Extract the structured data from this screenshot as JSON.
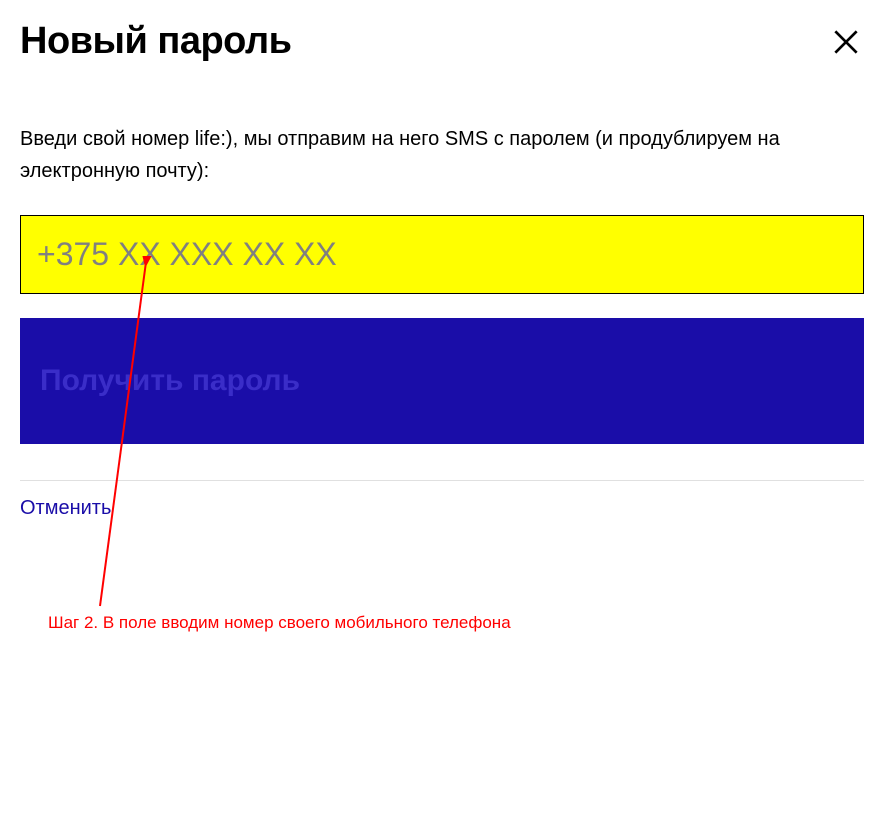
{
  "header": {
    "title": "Новый пароль"
  },
  "instruction": "Введи свой номер life:), мы отправим на него SMS с паролем (и продублируем на электронную почту):",
  "phone_input": {
    "placeholder": "+375 XX XXX XX XX"
  },
  "submit_button": {
    "label": "Получить пароль"
  },
  "cancel_link": {
    "label": "Отменить"
  },
  "annotation": {
    "text": "Шаг 2. В поле вводим номер своего мобильного телефона"
  }
}
